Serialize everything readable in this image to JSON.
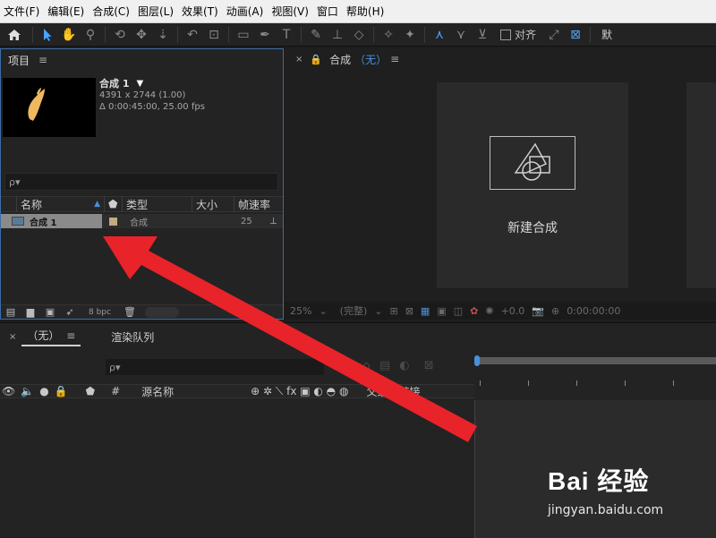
{
  "menubar": {
    "items": [
      "文件(F)",
      "编辑(E)",
      "合成(C)",
      "图层(L)",
      "效果(T)",
      "动画(A)",
      "视图(V)",
      "窗口",
      "帮助(H)"
    ]
  },
  "toolbar": {
    "align_label": "对齐",
    "right_label": "默"
  },
  "project": {
    "title": "项目",
    "comp_name": "合成 1",
    "dimensions": "4391 x 2744 (1.00)",
    "duration": "Δ 0:00:45:00, 25.00 fps",
    "search_placeholder": "ρ▾",
    "columns": [
      "名称",
      "类型",
      "大小",
      "帧速率"
    ],
    "row": {
      "name": "合成 1",
      "type": "合成",
      "fps": "25"
    },
    "footer_bpc": "8 bpc"
  },
  "composition": {
    "tab_prefix": "合成",
    "tab_value": "（无）",
    "new_comp_label": "新建合成",
    "bottombar": [
      "25%",
      "(完整)",
      "+0.0",
      "0:00:00:00"
    ]
  },
  "timeline": {
    "tab_none": "（无）",
    "tab_render": "渲染队列",
    "search_placeholder": "ρ▾",
    "header_hash": "#",
    "header_source": "源名称",
    "header_parent": "父级和链接"
  },
  "watermark": {
    "logo": "Bai 经验",
    "url": "jingyan.baidu.com"
  }
}
